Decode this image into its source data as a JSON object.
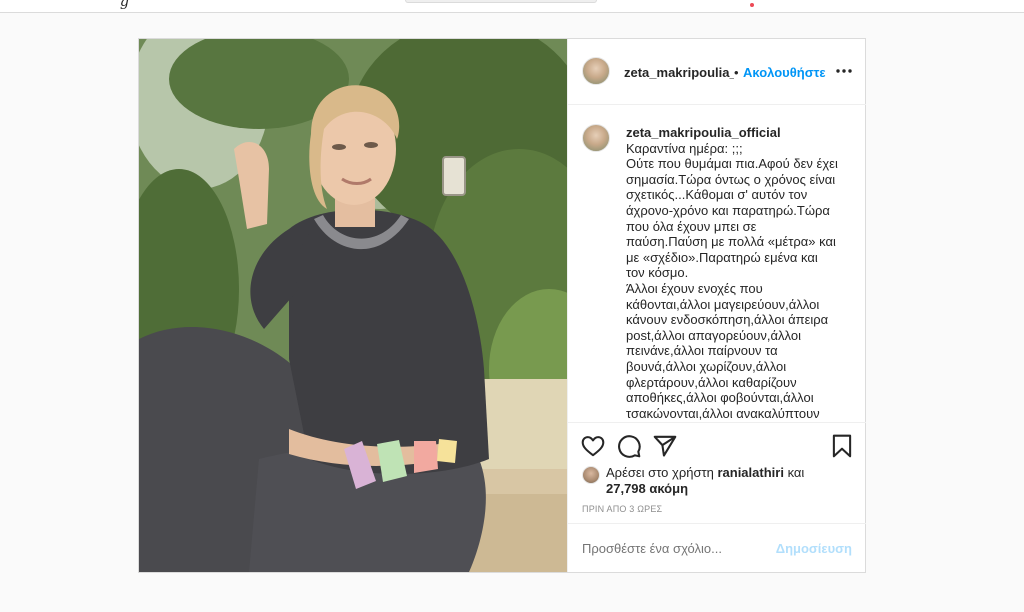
{
  "topbar": {
    "logo_fragment": "g"
  },
  "post": {
    "author": {
      "username_truncated": "zeta_makripoulia_c",
      "username": "zeta_makripoulia_official",
      "separator": "•",
      "follow_label": "Ακολουθήστε",
      "more_icon": "more-horizontal-icon"
    },
    "caption": {
      "text": "Καραντίνα ημέρα: ;;;\nΟύτε που θυμάμαι πια.Αφού δεν έχει σημασία.Τώρα όντως ο χρόνος είναι σχετικός...Κάθομαι σ' αυτόν τον άχρονο-χρόνο και παρατηρώ.Τώρα που όλα έχουν μπει σε παύση.Παύση με πολλά «μέτρα» και με «σχέδιο».Παρατηρώ εμένα και τον κόσμο.\nΆλλοι έχουν ενοχές που κάθονται,άλλοι μαγειρεύουν,άλλοι κάνουν ενδοσκόπηση,άλλοι άπειρα post,άλλοι απαγορεύουν,άλλοι πεινάνε,άλλοι παίρνουν τα βουνά,άλλοι χωρίζουν,άλλοι φλερτάρουν,άλλοι καθαρίζουν αποθήκες,άλλοι φοβούνται,άλλοι τσακώνονται,άλλοι ανακαλύπτουν"
    },
    "actions": {
      "like_icon": "heart-icon",
      "comment_icon": "comment-bubble-icon",
      "share_icon": "paper-plane-icon",
      "save_icon": "bookmark-icon"
    },
    "likes": {
      "prefix": "Αρέσει στο χρήστη",
      "liker": "ranialathiri",
      "conjunction": "και",
      "others_count": "27,798 ακόμη"
    },
    "timestamp": "ΠΡΙΝ ΑΠΟ 3 ΩΡΕΣ",
    "comment_input": {
      "placeholder": "Προσθέστε ένα σχόλιο...",
      "post_label": "Δημοσίευση"
    }
  },
  "colors": {
    "link_blue": "#0095f6",
    "post_disabled": "#b2dffc",
    "muted_text": "#8e8e8e",
    "border": "#dbdbdb",
    "notification_red": "#ed4956"
  }
}
